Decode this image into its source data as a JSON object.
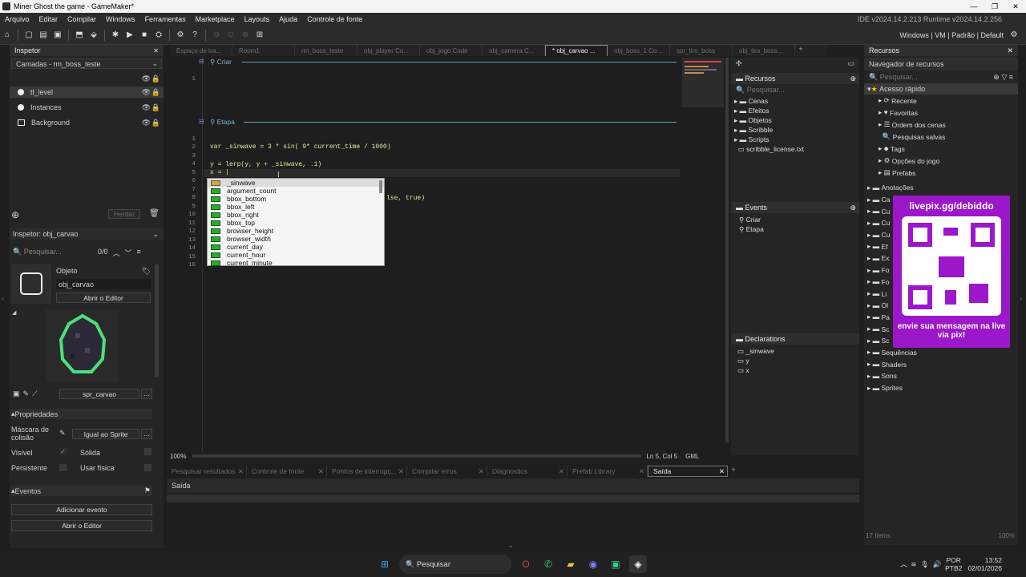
{
  "window": {
    "title": "Miner Ghost the game - GameMaker*",
    "min": "—",
    "max": "❐",
    "close": "✕"
  },
  "menu": [
    "Arquivo",
    "Editar",
    "Compilar",
    "Windows",
    "Ferramentas",
    "Marketplace",
    "Layouts",
    "Ajuda",
    "Controle de fonte"
  ],
  "version": "IDE v2024.14.2.213  Runtime v2024.14.2.256",
  "toolbar_right": [
    "Windows",
    "VM",
    "Padrão",
    "Default"
  ],
  "inspector": {
    "title": "Inspetor",
    "layers_select": "Camadas - rm_boss_teste",
    "layers": [
      "tl_level",
      "Instances",
      "Background"
    ],
    "herdar": "Herdar",
    "obj_select": "Inspetor: obj_carvao",
    "search_placeholder": "Pesquisar...",
    "count": "0/0",
    "objeto_label": "Objeto",
    "obj_name": "obj_carvao",
    "open_editor": "Abrir o Editor",
    "sprite": "spr_carvao",
    "props_title": "Propriedades",
    "mask_label": "Máscara de colisão",
    "mask_value": "Igual ao Sprite",
    "visible": "Visível",
    "solid": "Sólida",
    "persistent": "Persistente",
    "physics": "Usar física",
    "events_title": "Eventos",
    "add_event": "Adicionar evento",
    "open_editor2": "Abrir o Editor"
  },
  "tabs": [
    "Espaço de tra...",
    "Room1",
    "rm_boss_teste",
    "obj_player Co...",
    "obj_jogo Code",
    "obj_camera C...",
    "* obj_carvao ...",
    "obj_boss_1 Co...",
    "spr_tiro_boss",
    "obj_tiro_boss..."
  ],
  "editor": {
    "section1": "Criar",
    "section2": "Etapa",
    "lines1": [
      "1"
    ],
    "lines2": [
      "1",
      "2",
      "3",
      "4",
      "5",
      "6",
      "7",
      "8",
      "9",
      "10",
      "11",
      "12",
      "13",
      "14",
      "15",
      "16"
    ],
    "code": [
      "var _sinwave = 3 * sin( 9* current_time / 1000)",
      "",
      "y = lerp(y, y + _sinwave, .1)",
      "x = |"
    ],
    "partial": "lse, true)",
    "zoom": "100%",
    "pos": "Ln 5, Col 5",
    "lang": "GML"
  },
  "autocomplete": [
    "_sinwave",
    "argument_count",
    "bbox_bottom",
    "bbox_left",
    "bbox_right",
    "bbox_top",
    "browser_height",
    "browser_width",
    "current_day",
    "current_hour",
    "current_minute"
  ],
  "resources_mini": {
    "title": "Recursos",
    "search": "Pesquisar...",
    "items": [
      "Cenas",
      "Efeitos",
      "Objetos",
      "Scribble",
      "Scripts",
      "scribble_license.txt"
    ],
    "events_title": "Events",
    "events": [
      "Criar",
      "Etapa"
    ],
    "decl_title": "Declarations",
    "decls": [
      "_sinwave",
      "y",
      "x"
    ]
  },
  "resources": {
    "title": "Recursos",
    "browser": "Navegador de recursos",
    "search": "Pesquisar...",
    "quick": "Acesso rápido",
    "quick_items": [
      "Recente",
      "Favoritas",
      "Ordem dos cenas",
      "Pesquisas salvas",
      "Tags",
      "Opções do jogo",
      "Prefabs"
    ],
    "folders": [
      "Anotações",
      "Ca",
      "Cu",
      "Cu",
      "Cu",
      "Ef",
      "Ex",
      "Fo",
      "Fo",
      "Li",
      "Ol",
      "Pa",
      "Sc",
      "Sc",
      "Sequências",
      "Shaders",
      "Sons",
      "Sprites"
    ],
    "count": "17 Items",
    "zoom": "100%"
  },
  "promo": {
    "url": "livepix.gg/debiddo",
    "msg": "envie sua mensagem na live via pix!"
  },
  "bottom": {
    "tabs": [
      "Pesquisar resultados",
      "Controle de fonte",
      "Pontos de interrupç...",
      "Compilar erros",
      "Diagnostics",
      "Prefab Library",
      "Saída"
    ],
    "output_title": "Saída"
  },
  "taskbar": {
    "search": "Pesquisar",
    "lang": "POR",
    "layout": "PTB2",
    "time": "13:52",
    "date": "02/01/2026"
  }
}
